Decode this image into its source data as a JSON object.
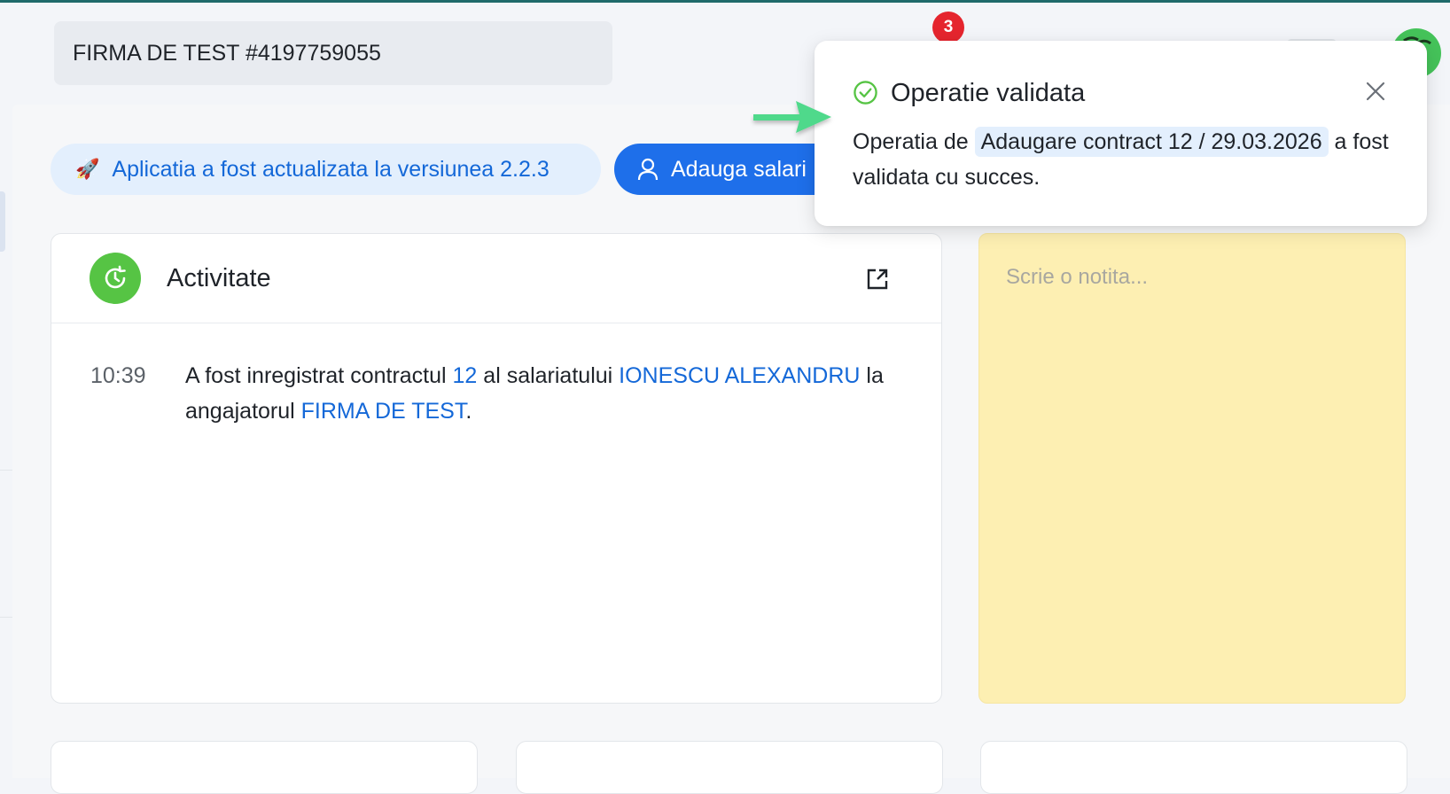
{
  "header": {
    "company_name": "FIRMA DE TEST #4197759055",
    "notification_count": "3"
  },
  "toolbar": {
    "update_icon": "rocket-icon",
    "update_text": "Aplicatia a fost actualizata la versiunea 2.2.3",
    "add_employee_label": "Adauga salari"
  },
  "activity": {
    "title": "Activitate",
    "entries": [
      {
        "time": "10:39",
        "text_1": "A fost inregistrat contractul ",
        "contract_link": "12",
        "text_2": " al salariatului ",
        "employee_link": "IONESCU ALEXANDRU",
        "text_3": " la angajatorul ",
        "employer_link": "FIRMA DE TEST",
        "text_4": "."
      }
    ]
  },
  "notes": {
    "placeholder": "Scrie o notita..."
  },
  "toast": {
    "title": "Operatie validata",
    "body_prefix": "Operatia de ",
    "body_highlight": "Adaugare contract 12 / 29.03.2026",
    "body_suffix": " a fost validata cu succes."
  },
  "colors": {
    "primary": "#1e6fea",
    "link": "#1468d8",
    "success": "#56c444",
    "badge": "#e5252e",
    "note": "#fdefb2",
    "arrow": "#4fd98b"
  }
}
